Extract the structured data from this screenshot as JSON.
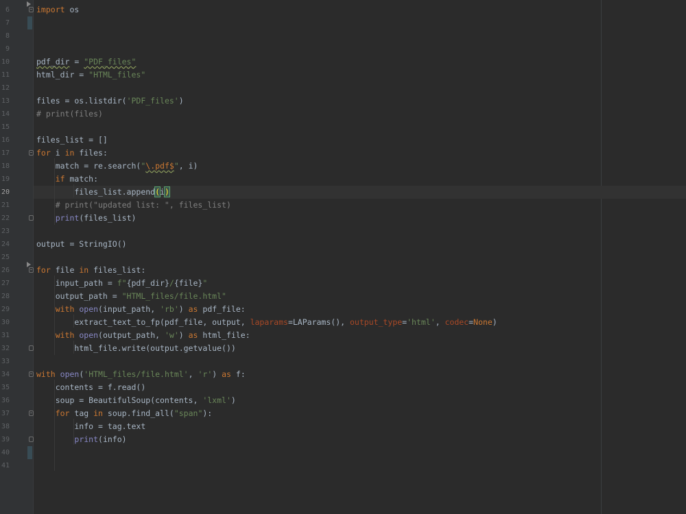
{
  "editor": {
    "language": "python",
    "current_line": 20,
    "line_numbers": [
      "6",
      "7",
      "8",
      "9",
      "10",
      "11",
      "12",
      "13",
      "14",
      "15",
      "16",
      "17",
      "18",
      "19",
      "20",
      "21",
      "22",
      "23",
      "24",
      "25",
      "26",
      "27",
      "28",
      "29",
      "30",
      "31",
      "32",
      "33",
      "34",
      "35",
      "36",
      "37",
      "38",
      "39",
      "40",
      "41"
    ],
    "lines": [
      [
        {
          "t": "import",
          "c": "kw"
        },
        {
          "t": " os"
        }
      ],
      [],
      [],
      [],
      [
        {
          "t": "pdf_dir",
          "c": "squig"
        },
        {
          "t": " = "
        },
        {
          "t": "\"PDF_files\"",
          "c": "str squig"
        }
      ],
      [
        {
          "t": "html_dir = "
        },
        {
          "t": "\"HTML_files\"",
          "c": "str"
        }
      ],
      [],
      [
        {
          "t": "files = os.listdir("
        },
        {
          "t": "'PDF_files'",
          "c": "str"
        },
        {
          "t": ")"
        }
      ],
      [
        {
          "t": "# print(files)",
          "c": "cmt"
        }
      ],
      [],
      [
        {
          "t": "files_list = []"
        }
      ],
      [
        {
          "t": "for",
          "c": "kw"
        },
        {
          "t": " i "
        },
        {
          "t": "in",
          "c": "kw"
        },
        {
          "t": " files:"
        }
      ],
      [
        {
          "t": "    match = re.search("
        },
        {
          "t": "\"",
          "c": "str"
        },
        {
          "t": "\\.pdf$",
          "c": "esc squig"
        },
        {
          "t": "\"",
          "c": "str"
        },
        {
          "t": ", i)"
        }
      ],
      [
        {
          "t": "    "
        },
        {
          "t": "if",
          "c": "kw"
        },
        {
          "t": " match:"
        }
      ],
      [
        {
          "t": "        files_list.append"
        },
        {
          "t": "(",
          "c": "match-brace"
        },
        {
          "t": "i"
        },
        {
          "t": ")",
          "c": "match-brace"
        }
      ],
      [
        {
          "t": "    # print(\"updated list: \", files_list)",
          "c": "cmt"
        }
      ],
      [
        {
          "t": "    "
        },
        {
          "t": "print",
          "c": "bi"
        },
        {
          "t": "(files_list)"
        }
      ],
      [],
      [
        {
          "t": "output = StringIO()"
        }
      ],
      [],
      [
        {
          "t": "for",
          "c": "kw"
        },
        {
          "t": " file "
        },
        {
          "t": "in",
          "c": "kw"
        },
        {
          "t": " files_list:"
        }
      ],
      [
        {
          "t": "    input_path = "
        },
        {
          "t": "f\"",
          "c": "str"
        },
        {
          "t": "{pdf_dir}"
        },
        {
          "t": "/",
          "c": "str"
        },
        {
          "t": "{file}"
        },
        {
          "t": "\"",
          "c": "str"
        }
      ],
      [
        {
          "t": "    output_path = "
        },
        {
          "t": "\"HTML_files/file.html\"",
          "c": "str"
        }
      ],
      [
        {
          "t": "    "
        },
        {
          "t": "with",
          "c": "kw"
        },
        {
          "t": " "
        },
        {
          "t": "open",
          "c": "bi"
        },
        {
          "t": "(input_path, "
        },
        {
          "t": "'rb'",
          "c": "str"
        },
        {
          "t": ") "
        },
        {
          "t": "as",
          "c": "kw"
        },
        {
          "t": " pdf_file:"
        }
      ],
      [
        {
          "t": "        extract_text_to_fp(pdf_file, output, "
        },
        {
          "t": "laparams",
          "c": "param"
        },
        {
          "t": "=LAParams(), "
        },
        {
          "t": "output_type",
          "c": "param"
        },
        {
          "t": "="
        },
        {
          "t": "'html'",
          "c": "str"
        },
        {
          "t": ", "
        },
        {
          "t": "codec",
          "c": "param"
        },
        {
          "t": "="
        },
        {
          "t": "None",
          "c": "kw"
        },
        {
          "t": ")"
        }
      ],
      [
        {
          "t": "    "
        },
        {
          "t": "with",
          "c": "kw"
        },
        {
          "t": " "
        },
        {
          "t": "open",
          "c": "bi"
        },
        {
          "t": "(output_path, "
        },
        {
          "t": "'w'",
          "c": "str"
        },
        {
          "t": ") "
        },
        {
          "t": "as",
          "c": "kw"
        },
        {
          "t": " html_file:"
        }
      ],
      [
        {
          "t": "        html_file.write(output.getvalue())"
        }
      ],
      [],
      [
        {
          "t": "with",
          "c": "kw"
        },
        {
          "t": " "
        },
        {
          "t": "open",
          "c": "bi"
        },
        {
          "t": "("
        },
        {
          "t": "'HTML_files/file.html'",
          "c": "str"
        },
        {
          "t": ", "
        },
        {
          "t": "'r'",
          "c": "str"
        },
        {
          "t": ") "
        },
        {
          "t": "as",
          "c": "kw"
        },
        {
          "t": " f:"
        }
      ],
      [
        {
          "t": "    contents = f.read()"
        }
      ],
      [
        {
          "t": "    soup = BeautifulSoup(contents, "
        },
        {
          "t": "'lxml'",
          "c": "str"
        },
        {
          "t": ")"
        }
      ],
      [
        {
          "t": "    "
        },
        {
          "t": "for",
          "c": "kw"
        },
        {
          "t": " tag "
        },
        {
          "t": "in",
          "c": "kw"
        },
        {
          "t": " soup.find_all("
        },
        {
          "t": "\"span\"",
          "c": "str"
        },
        {
          "t": "):"
        }
      ],
      [
        {
          "t": "        info = tag.text"
        }
      ],
      [
        {
          "t": "        "
        },
        {
          "t": "print",
          "c": "bi"
        },
        {
          "t": "(info)"
        }
      ],
      [],
      []
    ]
  }
}
